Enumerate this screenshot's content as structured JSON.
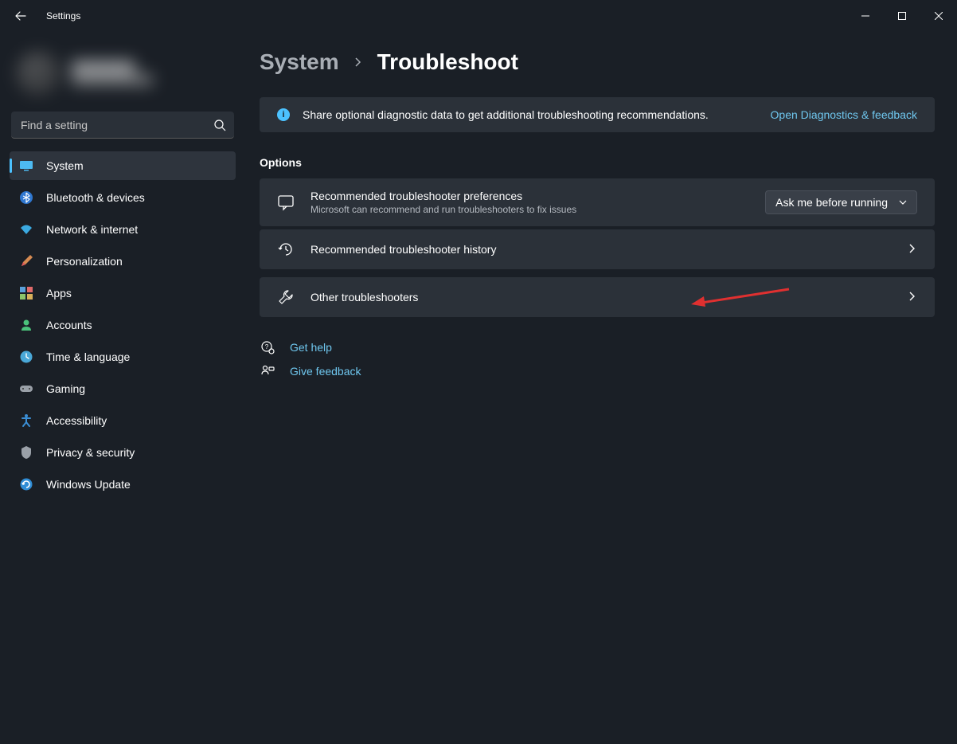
{
  "window": {
    "title": "Settings"
  },
  "search": {
    "placeholder": "Find a setting"
  },
  "sidebar": {
    "items": [
      {
        "label": "System"
      },
      {
        "label": "Bluetooth & devices"
      },
      {
        "label": "Network & internet"
      },
      {
        "label": "Personalization"
      },
      {
        "label": "Apps"
      },
      {
        "label": "Accounts"
      },
      {
        "label": "Time & language"
      },
      {
        "label": "Gaming"
      },
      {
        "label": "Accessibility"
      },
      {
        "label": "Privacy & security"
      },
      {
        "label": "Windows Update"
      }
    ]
  },
  "breadcrumb": {
    "parent": "System",
    "current": "Troubleshoot"
  },
  "banner": {
    "text": "Share optional diagnostic data to get additional troubleshooting recommendations.",
    "link": "Open Diagnostics & feedback"
  },
  "options": {
    "heading": "Options",
    "card1": {
      "title": "Recommended troubleshooter preferences",
      "sub": "Microsoft can recommend and run troubleshooters to fix issues",
      "dropdown_value": "Ask me before running"
    },
    "card2": {
      "title": "Recommended troubleshooter history"
    },
    "card3": {
      "title": "Other troubleshooters"
    }
  },
  "footer": {
    "help": "Get help",
    "feedback": "Give feedback"
  }
}
